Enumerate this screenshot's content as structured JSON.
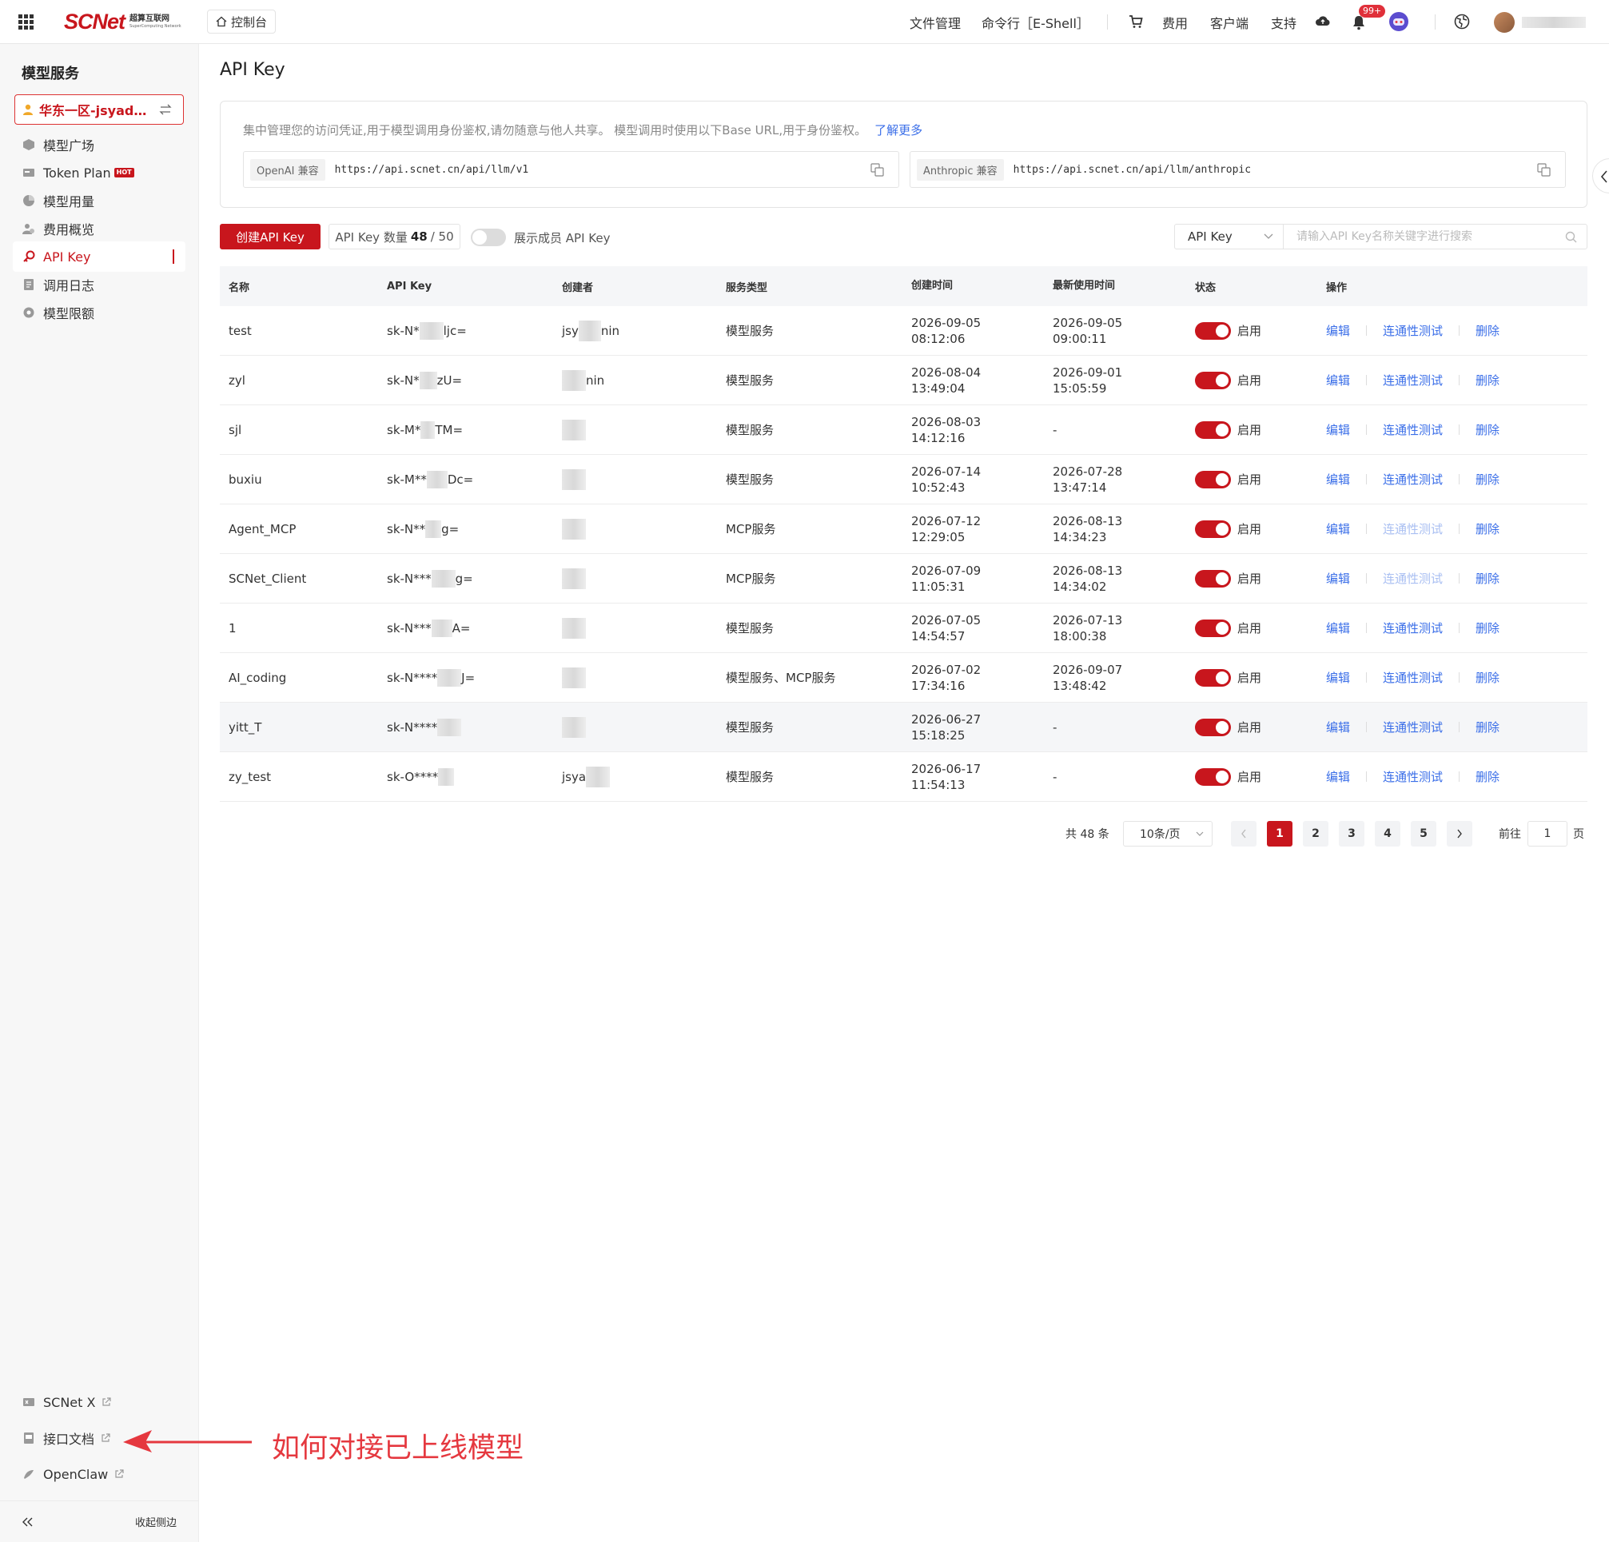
{
  "topbar": {
    "logo_text": "SCNet",
    "logo_cn": "超算互联网",
    "logo_en": "SuperComputing Network",
    "console_label": "控制台",
    "nav": [
      "文件管理",
      "命令行［E-Shell］",
      "费用",
      "客户端",
      "支持"
    ],
    "notification_badge": "99+"
  },
  "sidebar": {
    "title": "模型服务",
    "region_label": "华东一区-jsyadmi...",
    "items": [
      {
        "label": "模型广场"
      },
      {
        "label": "Token Plan",
        "badge": "HOT"
      },
      {
        "label": "模型用量"
      },
      {
        "label": "费用概览"
      },
      {
        "label": "API Key"
      },
      {
        "label": "调用日志"
      },
      {
        "label": "模型限额"
      }
    ],
    "bottom_items": [
      {
        "label": "SCNet X"
      },
      {
        "label": "接口文档"
      },
      {
        "label": "OpenClaw"
      }
    ],
    "collapse_label": "收起侧边"
  },
  "main": {
    "title": "API Key",
    "info_text": "集中管理您的访问凭证,用于模型调用身份鉴权,请勿随意与他人共享。  模型调用时使用以下Base URL,用于身份鉴权。",
    "learn_more": "了解更多",
    "openai_tag": "OpenAI 兼容",
    "openai_url": "https://api.scnet.cn/api/llm/v1",
    "anthropic_tag": "Anthropic 兼容",
    "anthropic_url": "https://api.scnet.cn/api/llm/anthropic",
    "create_button": "创建API Key",
    "count_label": "API Key 数量",
    "count_value": "48",
    "count_max": "/ 50",
    "show_members_label": "展示成员 API Key",
    "search_select": "API Key",
    "search_placeholder": "请输入API Key名称关键字进行搜索"
  },
  "table": {
    "headers": [
      "名称",
      "API Key",
      "创建者",
      "服务类型",
      "创建时间",
      "最新使用时间",
      "状态",
      "操作"
    ],
    "rows": [
      {
        "name": "test",
        "key_prefix": "sk-N*",
        "key_suffix": "ljc=",
        "creator_prefix": "jsy",
        "creator_suffix": "nin",
        "type": "模型服务",
        "created_date": "2026-09-05",
        "created_time": "08:12:06",
        "last_date": "2026-09-05",
        "last_time": "09:00:11",
        "status": "启用",
        "test_enabled": true
      },
      {
        "name": "zyl",
        "key_prefix": "sk-N*",
        "key_suffix": "zU=",
        "creator_prefix": "",
        "creator_suffix": "nin",
        "type": "模型服务",
        "created_date": "2026-08-04",
        "created_time": "13:49:04",
        "last_date": "2026-09-01",
        "last_time": "15:05:59",
        "status": "启用",
        "test_enabled": true
      },
      {
        "name": "sjl",
        "key_prefix": "sk-M*",
        "key_suffix": "TM=",
        "creator_prefix": "",
        "creator_suffix": "",
        "type": "模型服务",
        "created_date": "2026-08-03",
        "created_time": "14:12:16",
        "last_date": "-",
        "last_time": "",
        "status": "启用",
        "test_enabled": true
      },
      {
        "name": "buxiu",
        "key_prefix": "sk-M**",
        "key_suffix": "Dc=",
        "creator_prefix": "",
        "creator_suffix": "",
        "type": "模型服务",
        "created_date": "2026-07-14",
        "created_time": "10:52:43",
        "last_date": "2026-07-28",
        "last_time": "13:47:14",
        "status": "启用",
        "test_enabled": true
      },
      {
        "name": "Agent_MCP",
        "key_prefix": "sk-N**",
        "key_suffix": "g=",
        "creator_prefix": "",
        "creator_suffix": "",
        "type": "MCP服务",
        "created_date": "2026-07-12",
        "created_time": "12:29:05",
        "last_date": "2026-08-13",
        "last_time": "14:34:23",
        "status": "启用",
        "test_enabled": false
      },
      {
        "name": "SCNet_Client",
        "key_prefix": "sk-N***",
        "key_suffix": "g=",
        "creator_prefix": "",
        "creator_suffix": "",
        "type": "MCP服务",
        "created_date": "2026-07-09",
        "created_time": "11:05:31",
        "last_date": "2026-08-13",
        "last_time": "14:34:02",
        "status": "启用",
        "test_enabled": false
      },
      {
        "name": "1",
        "key_prefix": "sk-N***",
        "key_suffix": "A=",
        "creator_prefix": "",
        "creator_suffix": "",
        "type": "模型服务",
        "created_date": "2026-07-05",
        "created_time": "14:54:57",
        "last_date": "2026-07-13",
        "last_time": "18:00:38",
        "status": "启用",
        "test_enabled": true
      },
      {
        "name": "AI_coding",
        "key_prefix": "sk-N****",
        "key_suffix": "J=",
        "creator_prefix": "",
        "creator_suffix": "",
        "type": "模型服务、MCP服务",
        "created_date": "2026-07-02",
        "created_time": "17:34:16",
        "last_date": "2026-09-07",
        "last_time": "13:48:42",
        "status": "启用",
        "test_enabled": true
      },
      {
        "name": "yitt_T",
        "key_prefix": "sk-N****",
        "key_suffix": "",
        "creator_prefix": "",
        "creator_suffix": "",
        "type": "模型服务",
        "created_date": "2026-06-27",
        "created_time": "15:18:25",
        "last_date": "-",
        "last_time": "",
        "status": "启用",
        "test_enabled": true
      },
      {
        "name": "zy_test",
        "key_prefix": "sk-O****",
        "key_suffix": "",
        "creator_prefix": "jsya",
        "creator_suffix": "",
        "type": "模型服务",
        "created_date": "2026-06-17",
        "created_time": "11:54:13",
        "last_date": "-",
        "last_time": "",
        "status": "启用",
        "test_enabled": true
      }
    ],
    "op_edit": "编辑",
    "op_test": "连通性测试",
    "op_delete": "删除"
  },
  "pagination": {
    "total_label": "共 48 条",
    "page_size": "10条/页",
    "pages": [
      "1",
      "2",
      "3",
      "4",
      "5"
    ],
    "current_page": "1",
    "goto_label": "前往",
    "goto_value": "1",
    "page_unit": "页"
  },
  "annotation": {
    "text": "如何对接已上线模型"
  },
  "colors": {
    "brand": "#c8161d",
    "link": "#3a6ee8",
    "annotation": "#e5383f"
  }
}
